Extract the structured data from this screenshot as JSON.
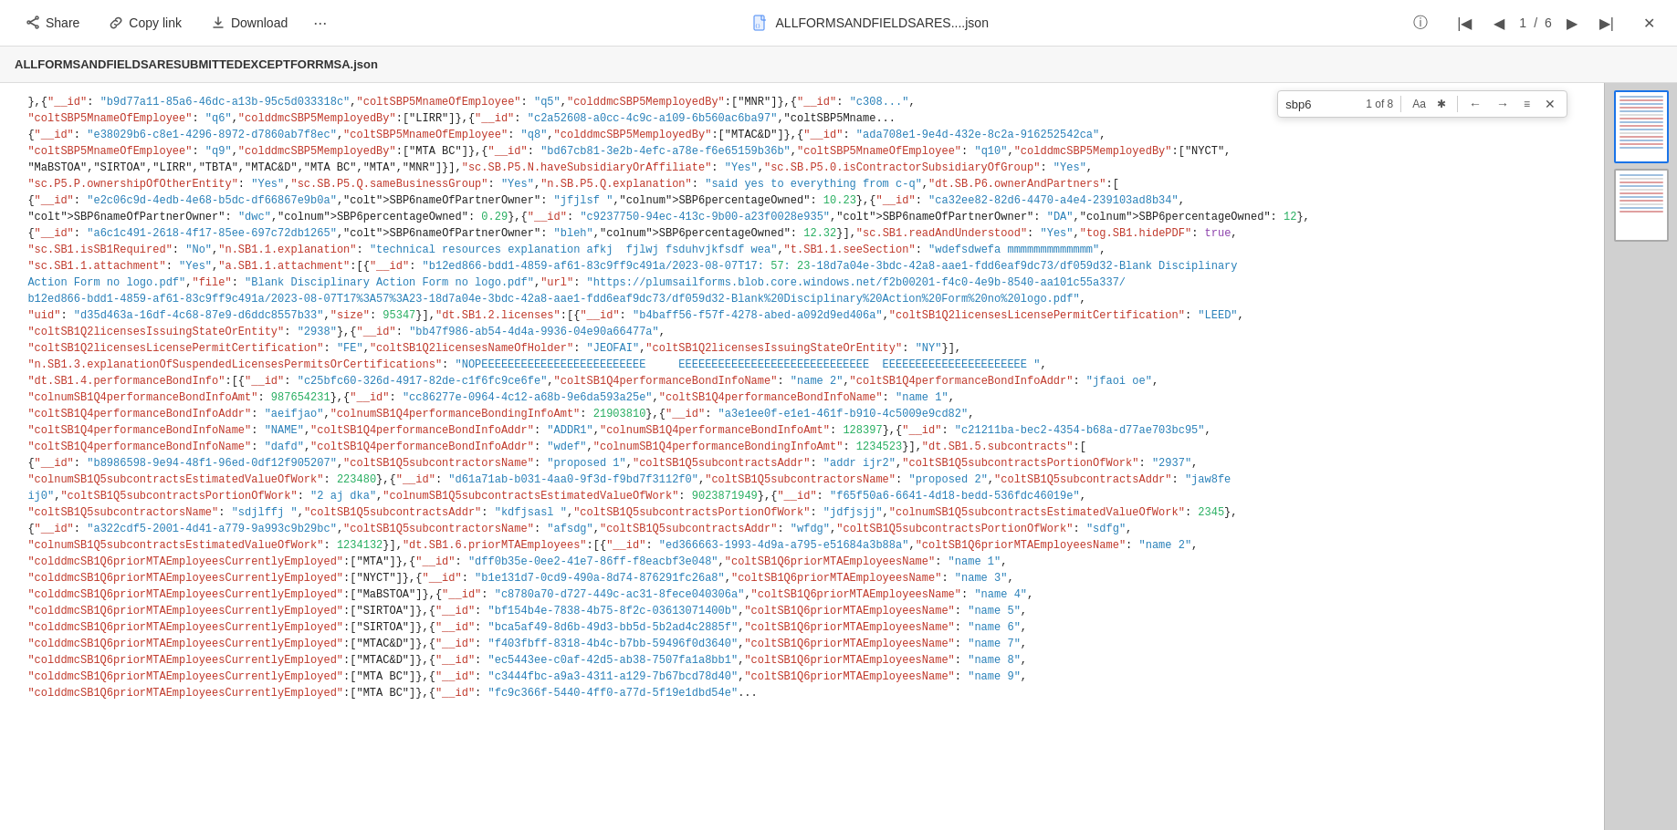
{
  "topbar": {
    "share_label": "Share",
    "copy_link_label": "Copy link",
    "download_label": "Download",
    "more_label": "···",
    "filename": "ALLFORMSANDFIELDSARES....json",
    "page_current": "1",
    "page_total": "6",
    "page_separator": "/"
  },
  "file_title": "ALLFORMSANDFIELDSARESUBMITTEDEXCEPTFORRMSA.json",
  "search": {
    "query": "sbp6",
    "counter": "1 of 8",
    "aa_label": "Aa",
    "star_label": "✱",
    "prev_label": "←",
    "next_label": "→",
    "menu_label": "≡",
    "close_label": "✕"
  },
  "json_text": "see inline rendering"
}
